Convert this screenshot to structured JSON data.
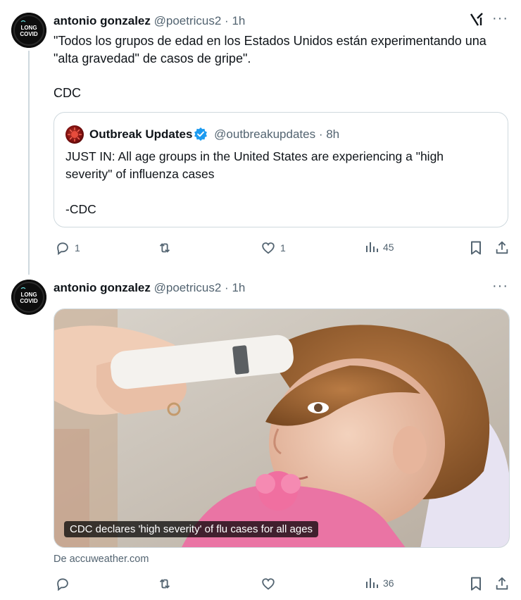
{
  "tweet1": {
    "name": "antonio gonzalez",
    "handle": "@poetricus2",
    "time": "1h",
    "text_line1": "\"Todos los grupos de edad en los Estados Unidos están experimentando una",
    "text_line2": "\"alta gravedad\" de casos de gripe\".",
    "text_line3": "CDC",
    "quote": {
      "name": "Outbreak Updates",
      "handle": "@outbreakupdates",
      "time": "8h",
      "text_line1": "JUST IN: All age groups in the United States are experiencing a \"high",
      "text_line2": "severity\" of influenza cases",
      "text_line3": "-CDC"
    },
    "replies": "1",
    "likes": "1",
    "views": "45"
  },
  "tweet2": {
    "name": "antonio gonzalez",
    "handle": "@poetricus2",
    "time": "1h",
    "media_caption": "CDC declares 'high severity' of flu cases for all ages",
    "source": "De accuweather.com",
    "views": "36"
  },
  "avatar_text": {
    "top": "LONG",
    "bottom": "COVID"
  },
  "separator": "·",
  "more_label": "···",
  "icons": {
    "reply": "reply-icon",
    "retweet": "retweet-icon",
    "like": "heart-icon",
    "views": "views-icon",
    "bookmark": "bookmark-icon",
    "share": "share-icon",
    "grok": "grok-icon"
  },
  "colors": {
    "accent": "#1d9bf0",
    "muted": "#536471",
    "border": "#cfd9de",
    "text": "#0f1419"
  }
}
